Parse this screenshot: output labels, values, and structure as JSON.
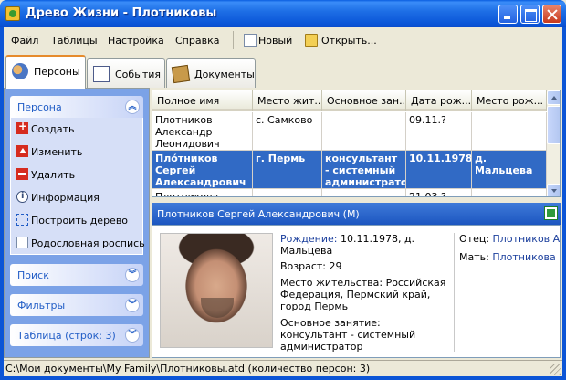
{
  "window": {
    "title": "Древо Жизни - Плотниковы"
  },
  "menu": {
    "items": [
      "Файл",
      "Таблицы",
      "Настройка",
      "Справка"
    ],
    "toolbar": {
      "new_label": "Новый",
      "open_label": "Открыть..."
    }
  },
  "tabs": [
    {
      "label": "Персоны",
      "active": true
    },
    {
      "label": "События",
      "active": false
    },
    {
      "label": "Документы",
      "active": false
    }
  ],
  "sidebar": {
    "person_group": {
      "title": "Персона",
      "tasks": [
        "Создать",
        "Изменить",
        "Удалить",
        "Информация",
        "Построить дерево",
        "Родословная роспись"
      ]
    },
    "search_group": {
      "title": "Поиск"
    },
    "filters_group": {
      "title": "Фильтры"
    },
    "table_group": {
      "title": "Таблица (строк: 3)"
    }
  },
  "grid": {
    "columns": [
      "Полное имя",
      "Место жит...",
      "Основное зан...",
      "Дата рож...",
      "Место рож..."
    ],
    "rows": [
      {
        "name": "Плотников Александр Леонидович",
        "residence": "с. Самково",
        "occupation": "",
        "birth_date": "09.11.?",
        "birth_place": "",
        "selected": false
      },
      {
        "name": "Пло́тников Сергей Александрович",
        "residence": "г. Пермь",
        "occupation": "консультант - системный администратор",
        "birth_date": "10.11.1978",
        "birth_place": "д. Мальцева",
        "selected": true
      },
      {
        "name": "Плотникова Галина",
        "residence": "",
        "occupation": "",
        "birth_date": "21.03.?",
        "birth_place": "",
        "selected": false
      }
    ]
  },
  "detail": {
    "title": "Плотников Сергей Александрович (М)",
    "birth_label": "Рождение:",
    "birth_value": " 10.11.1978, д. Мальцева",
    "age": "Возраст: 29",
    "residence": "Место жительства: Российская Федерация, Пермский край, город Пермь",
    "occupation": "Основное занятие: консультант - системный администратор",
    "father_label": "Отец:",
    "father_name": "Плотников Алек",
    "mother_label": "Мать:",
    "mother_name": "Плотникова Гал"
  },
  "status": {
    "text": "C:\\Мои документы\\My Family\\Плотниковы.atd (количество персон: 3)"
  },
  "colors": {
    "title_bar": "#0b56d8",
    "sidebar_bg": "#7ba2e7",
    "selection": "#316ac5",
    "link": "#1a3e9c",
    "active_tab_accent": "#e68b2c"
  }
}
